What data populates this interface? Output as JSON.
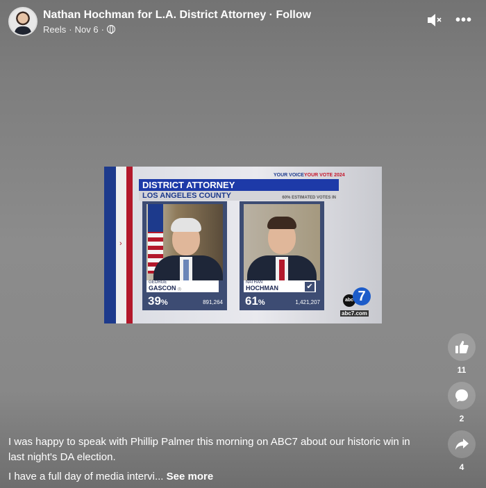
{
  "header": {
    "page_name": "Nathan Hochman for L.A. District Attorney",
    "separator": " · ",
    "follow_label": "Follow",
    "post_type": "Reels",
    "date": "Nov 6",
    "icons": [
      "avatar",
      "globe-icon",
      "mute-icon",
      "more-icon"
    ]
  },
  "video": {
    "tagline_a": "YOUR VOICE",
    "tagline_b": "YOUR VOTE 2024",
    "banner": "DISTRICT ATTORNEY",
    "subbanner": "LOS ANGELES COUNTY",
    "precincts": "60% ESTIMATED VOTES IN",
    "candidates": [
      {
        "first": "GEORGE",
        "last": "GASCON",
        "incumbent": "(I)",
        "percent": "39",
        "votes": "891,264"
      },
      {
        "first": "NATHAN",
        "last": "HOCHMAN",
        "percent": "61",
        "votes": "1,421,207",
        "winner": true
      }
    ],
    "station": "abc",
    "channel": "7",
    "url": "abc7.com"
  },
  "actions": {
    "likes": "11",
    "comments": "2",
    "shares": "4"
  },
  "caption": {
    "line1": "I was happy to speak with Phillip Palmer this morning on ABC7 about our historic win in last night's DA election.",
    "line2": "I have a full day of media intervi...",
    "see_more": "See more"
  },
  "colors": {
    "brand_blue": "#1d3aa8",
    "red": "#b3182b",
    "card": "#3d4c73"
  }
}
